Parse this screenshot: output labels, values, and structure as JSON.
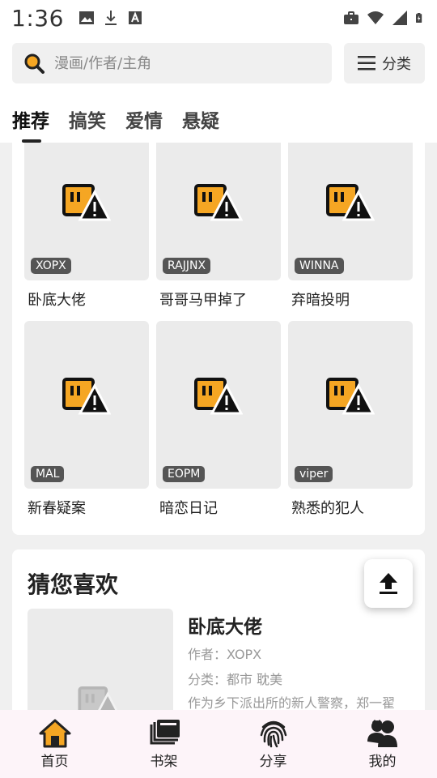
{
  "status_bar": {
    "time": "1:36"
  },
  "search": {
    "placeholder": "漫画/作者/主角"
  },
  "category_button": {
    "label": "分类"
  },
  "tabs": [
    {
      "label": "推荐",
      "active": true
    },
    {
      "label": "搞笑",
      "active": false
    },
    {
      "label": "爱情",
      "active": false
    },
    {
      "label": "悬疑",
      "active": false
    }
  ],
  "grid": [
    {
      "tag": "XOPX",
      "title": "卧底大佬"
    },
    {
      "tag": "RAJJNX",
      "title": "哥哥马甲掉了"
    },
    {
      "tag": "WINNA",
      "title": "弃暗投明"
    },
    {
      "tag": "MAL",
      "title": "新春疑案"
    },
    {
      "tag": "EOPM",
      "title": "暗恋日记"
    },
    {
      "tag": "viper",
      "title": "熟悉的犯人"
    }
  ],
  "guess": {
    "heading": "猜您喜欢",
    "name": "卧底大佬",
    "author": "作者：XOPX",
    "category": "分类：都市 耽美",
    "description": "作为乡下派出所的新人警察，郑一翟"
  },
  "bottom_nav": [
    {
      "label": "首页",
      "icon": "home-icon",
      "active": true
    },
    {
      "label": "书架",
      "icon": "bookshelf-icon",
      "active": false
    },
    {
      "label": "分享",
      "icon": "fingerprint-icon",
      "active": false
    },
    {
      "label": "我的",
      "icon": "people-icon",
      "active": false
    }
  ],
  "colors": {
    "accent": "#f5a623",
    "icon_dark": "#222222"
  }
}
